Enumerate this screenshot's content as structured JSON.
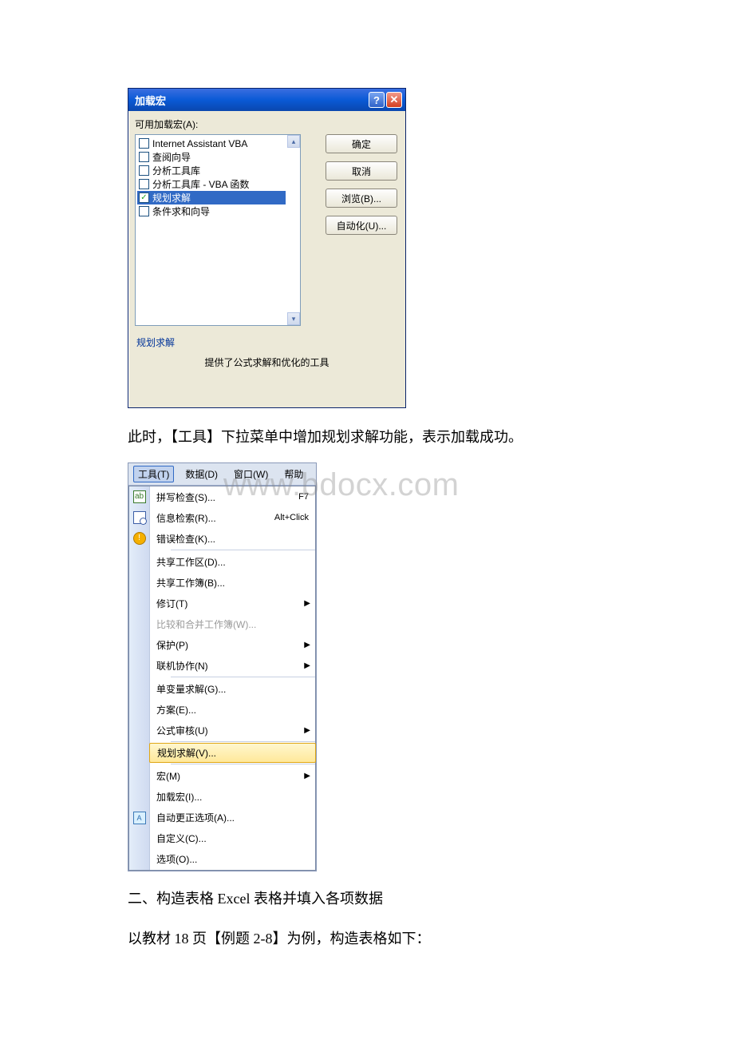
{
  "dialog": {
    "title": "加载宏",
    "available_label": "可用加载宏(A):",
    "items": [
      {
        "label": "Internet Assistant VBA",
        "checked": false,
        "selected": false
      },
      {
        "label": "查阅向导",
        "checked": false,
        "selected": false
      },
      {
        "label": "分析工具库",
        "checked": false,
        "selected": false
      },
      {
        "label": "分析工具库 - VBA 函数",
        "checked": false,
        "selected": false
      },
      {
        "label": "规划求解",
        "checked": true,
        "selected": true
      },
      {
        "label": "条件求和向导",
        "checked": false,
        "selected": false
      }
    ],
    "buttons": {
      "ok": "确定",
      "cancel": "取消",
      "browse": "浏览(B)...",
      "automation": "自动化(U)..."
    },
    "group_name": "规划求解",
    "group_desc": "提供了公式求解和优化的工具"
  },
  "para1": "此时，【工具】下拉菜单中增加规划求解功能，表示加载成功。",
  "watermark": "www.bdocx.com",
  "menubar": {
    "tools": "工具(T)",
    "data": "数据(D)",
    "window": "窗口(W)",
    "help": "帮助"
  },
  "menu_items": {
    "spell": {
      "label": "拼写检查(S)...",
      "accel": "F7"
    },
    "research": {
      "label": "信息检索(R)...",
      "accel": "Alt+Click"
    },
    "errorcheck": {
      "label": "错误检查(K)..."
    },
    "sharedws": {
      "label": "共享工作区(D)..."
    },
    "sharewb": {
      "label": "共享工作簿(B)..."
    },
    "track": {
      "label": "修订(T)"
    },
    "compare": {
      "label": "比较和合并工作簿(W)..."
    },
    "protect": {
      "label": "保护(P)"
    },
    "online": {
      "label": "联机协作(N)"
    },
    "goalseek": {
      "label": "单变量求解(G)..."
    },
    "scenarios": {
      "label": "方案(E)..."
    },
    "audit": {
      "label": "公式审核(U)"
    },
    "solver": {
      "label": "规划求解(V)..."
    },
    "macro": {
      "label": "宏(M)"
    },
    "addins": {
      "label": "加载宏(I)..."
    },
    "autocorrect": {
      "label": "自动更正选项(A)..."
    },
    "customize": {
      "label": "自定义(C)..."
    },
    "options": {
      "label": "选项(O)..."
    }
  },
  "para2": "二、构造表格 Excel 表格并填入各项数据",
  "para3": "以教材 18 页【例题 2-8】为例，构造表格如下："
}
